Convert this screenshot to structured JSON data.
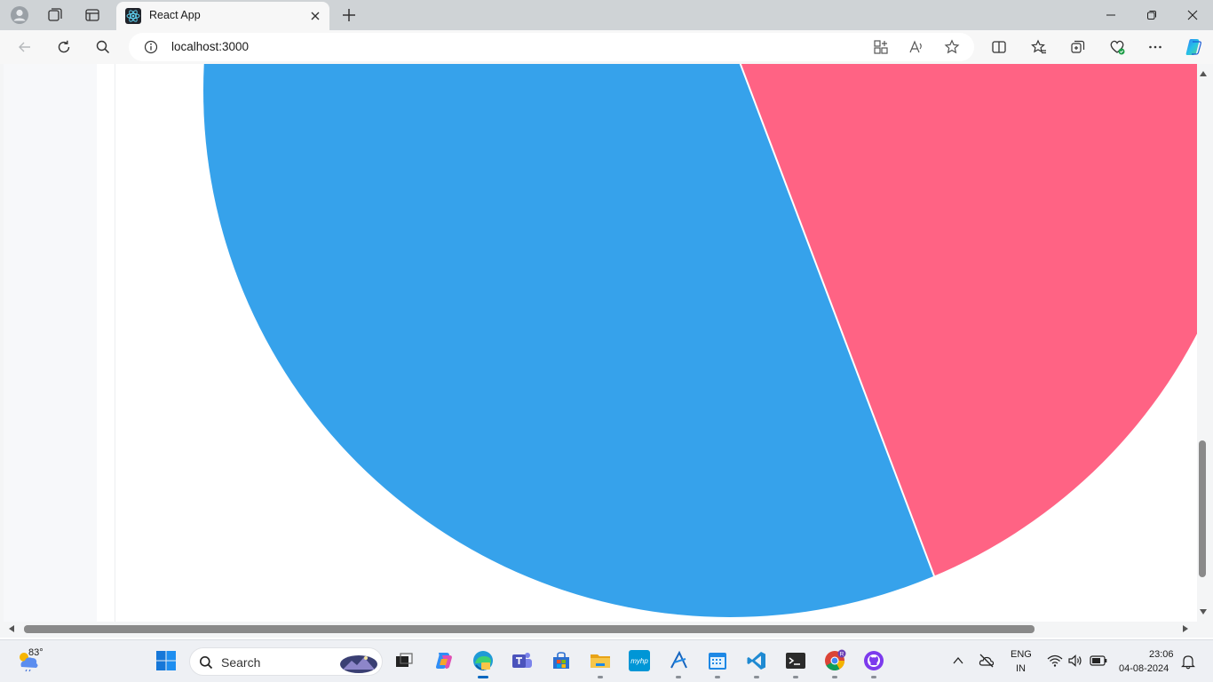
{
  "browser": {
    "tab_title": "React App",
    "url": "localhost:3000"
  },
  "chart_data": {
    "type": "pie",
    "series": [
      {
        "name": "",
        "color": "#36a2eb"
      },
      {
        "name": "",
        "color": "#ff6384"
      }
    ],
    "border_color": "#ffffff",
    "note_visible_portion_only": true
  },
  "taskbar": {
    "weather_temp": "83°",
    "search_label": "Search",
    "language_line1": "ENG",
    "language_line2": "IN",
    "time": "23:06",
    "date": "04-08-2024"
  },
  "colors": {
    "accent": "#0067c0",
    "pie_blue": "#36a2eb",
    "pie_pink": "#ff6384"
  }
}
